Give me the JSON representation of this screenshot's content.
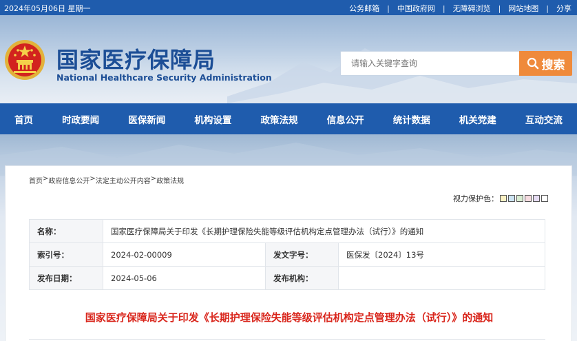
{
  "topbar": {
    "date": "2024年05月06日 星期一",
    "links": [
      "公务邮箱",
      "中国政府网",
      "无障碍浏览",
      "网站地图",
      "分享"
    ]
  },
  "header": {
    "title_cn": "国家医疗保障局",
    "title_en": "National Healthcare Security Administration",
    "search_placeholder": "请输入关键字查询",
    "search_button": "搜索"
  },
  "nav": {
    "items": [
      "首页",
      "时政要闻",
      "医保新闻",
      "机构设置",
      "政策法规",
      "信息公开",
      "统计数据",
      "机关党建",
      "互动交流"
    ]
  },
  "breadcrumb": [
    "首页",
    "政府信息公开",
    "法定主动公开内容",
    "政策法规"
  ],
  "vision_protect": {
    "label": "视力保护色：",
    "colors": [
      "#fbf2c4",
      "#cde4f2",
      "#d9ecd2",
      "#f6dbe0",
      "#e6dcf3",
      "#ffffff"
    ]
  },
  "meta": {
    "name_label": "名称：",
    "name_value": "国家医疗保障局关于印发《长期护理保险失能等级评估机构定点管理办法（试行）》的通知",
    "index_label": "索引号：",
    "index_value": "2024-02-00009",
    "docno_label": "发文字号：",
    "docno_value": "医保发〔2024〕13号",
    "date_label": "发布日期：",
    "date_value": "2024-05-06",
    "org_label": "发布机构：",
    "org_value": ""
  },
  "document": {
    "title": "国家医疗保障局关于印发《长期护理保险失能等级评估机构定点管理办法（试行）》的通知"
  }
}
